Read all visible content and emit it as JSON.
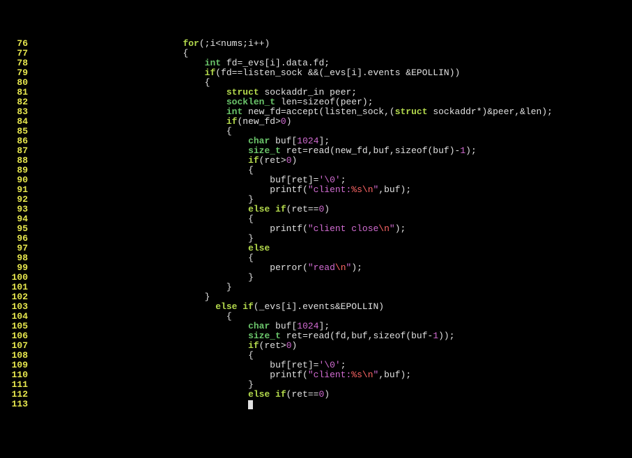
{
  "gutter": [
    "76",
    "77",
    "78",
    "79",
    "80",
    "81",
    "82",
    "83",
    "84",
    "85",
    "86",
    "87",
    "88",
    "89",
    "90",
    "91",
    "92",
    "93",
    "94",
    "95",
    "96",
    "97",
    "98",
    "99",
    "100",
    "101",
    "102",
    "103",
    "104",
    "105",
    "106",
    "107",
    "108",
    "109",
    "110",
    "111",
    "112",
    "113"
  ],
  "tokens": {
    "for": "for",
    "if": "if",
    "else": "else",
    "else_if": "else if",
    "struct": "struct",
    "int": "int",
    "char": "char",
    "size_t": "size_t",
    "socklen_t": "socklen_t"
  },
  "numbers": {
    "zero": "0",
    "one": "1",
    "buf1024": "1024"
  },
  "strings": {
    "client_pre": "\"client:",
    "pct_s": "%s",
    "nl": "\\n",
    "quote_end": "\"",
    "client_close_pre": "\"client close",
    "read_pre": "\"read"
  },
  "chars": {
    "nul_pre": "'\\0",
    "nul_suf": "'"
  },
  "code": {
    "l76": "(;i<nums;i++)",
    "l77": "{",
    "l78a": " fd=_evs[i].data.fd;",
    "l79a": "(fd==listen_sock &&(_evs[i].events &EPOLLIN))",
    "l80": "{",
    "l81a": " sockaddr_in peer;",
    "l82": " len=sizeof(peer);",
    "l83a": " new_fd=accept(listen_sock,(",
    "l83b": " sockaddr*)&peer,&len);",
    "l84a": "(new_fd>",
    "l84b": ")",
    "l85": "{",
    "l86a": " buf[",
    "l86b": "];",
    "l87a": " ret=read(new_fd,buf,sizeof(buf)-",
    "l87b": ");",
    "l88a": "(ret>",
    "l88b": ")",
    "l89": "{",
    "l90a": "buf[ret]=",
    "l90b": ";",
    "l91a": "printf(",
    "l91b": ",buf);",
    "l92": "}",
    "l93a": "(ret==",
    "l93b": ")",
    "l94": "{",
    "l95a": "printf(",
    "l95b": ");",
    "l96": "}",
    "l98": "{",
    "l99a": "perror(",
    "l99b": ");",
    "l100": "}",
    "l101": "}",
    "l102": "}",
    "l103a": "(_evs[i].events&EPOLLIN)",
    "l104": "{",
    "l105a": " buf[",
    "l105b": "];",
    "l106a": " ret=read(fd,buf,sizeof(buf-",
    "l106b": "));",
    "l107a": "(ret>",
    "l107b": ")",
    "l108": "{",
    "l109a": "buf[ret]=",
    "l109b": ";",
    "l110a": "printf(",
    "l110b": ",buf);",
    "l111": "}",
    "l112a": "(ret==",
    "l112b": ")"
  },
  "indent": {
    "i24": "                        ",
    "i28": "                            ",
    "i32": "                                ",
    "i34": "                                  ",
    "i36": "                                    ",
    "i38": "                                      ",
    "i40": "                                        ",
    "i44": "                                            "
  }
}
